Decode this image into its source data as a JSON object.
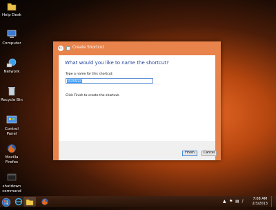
{
  "desktop": {
    "icons": [
      {
        "label": "Help Desk",
        "kind": "folder"
      },
      {
        "label": "Computer",
        "kind": "computer"
      },
      {
        "label": "Network",
        "kind": "network"
      },
      {
        "label": "Recycle Bin",
        "kind": "recycle-bin"
      },
      {
        "label": "Control Panel",
        "kind": "control-panel"
      },
      {
        "label": "Mozilla Firefox",
        "kind": "firefox"
      },
      {
        "label": "shutdown command",
        "kind": "shortcut"
      }
    ]
  },
  "dialog": {
    "title": "Create Shortcut",
    "heading": "What would you like to name the shortcut?",
    "name_label": "Type a name for this shortcut:",
    "name_value": "shutdown",
    "finish_instruction": "Click Finish to create the shortcut.",
    "finish_label": "Finish",
    "cancel_label": "Cancel",
    "back_glyph": "←"
  },
  "taskbar": {
    "time": "7:08 AM",
    "date": "2/3/2013",
    "pinned": [
      "internet-explorer",
      "file-explorer",
      "firefox"
    ]
  },
  "colors": {
    "dialog_frame": "#e8834b",
    "heading": "#1e3f99",
    "selection": "#3399ff"
  }
}
